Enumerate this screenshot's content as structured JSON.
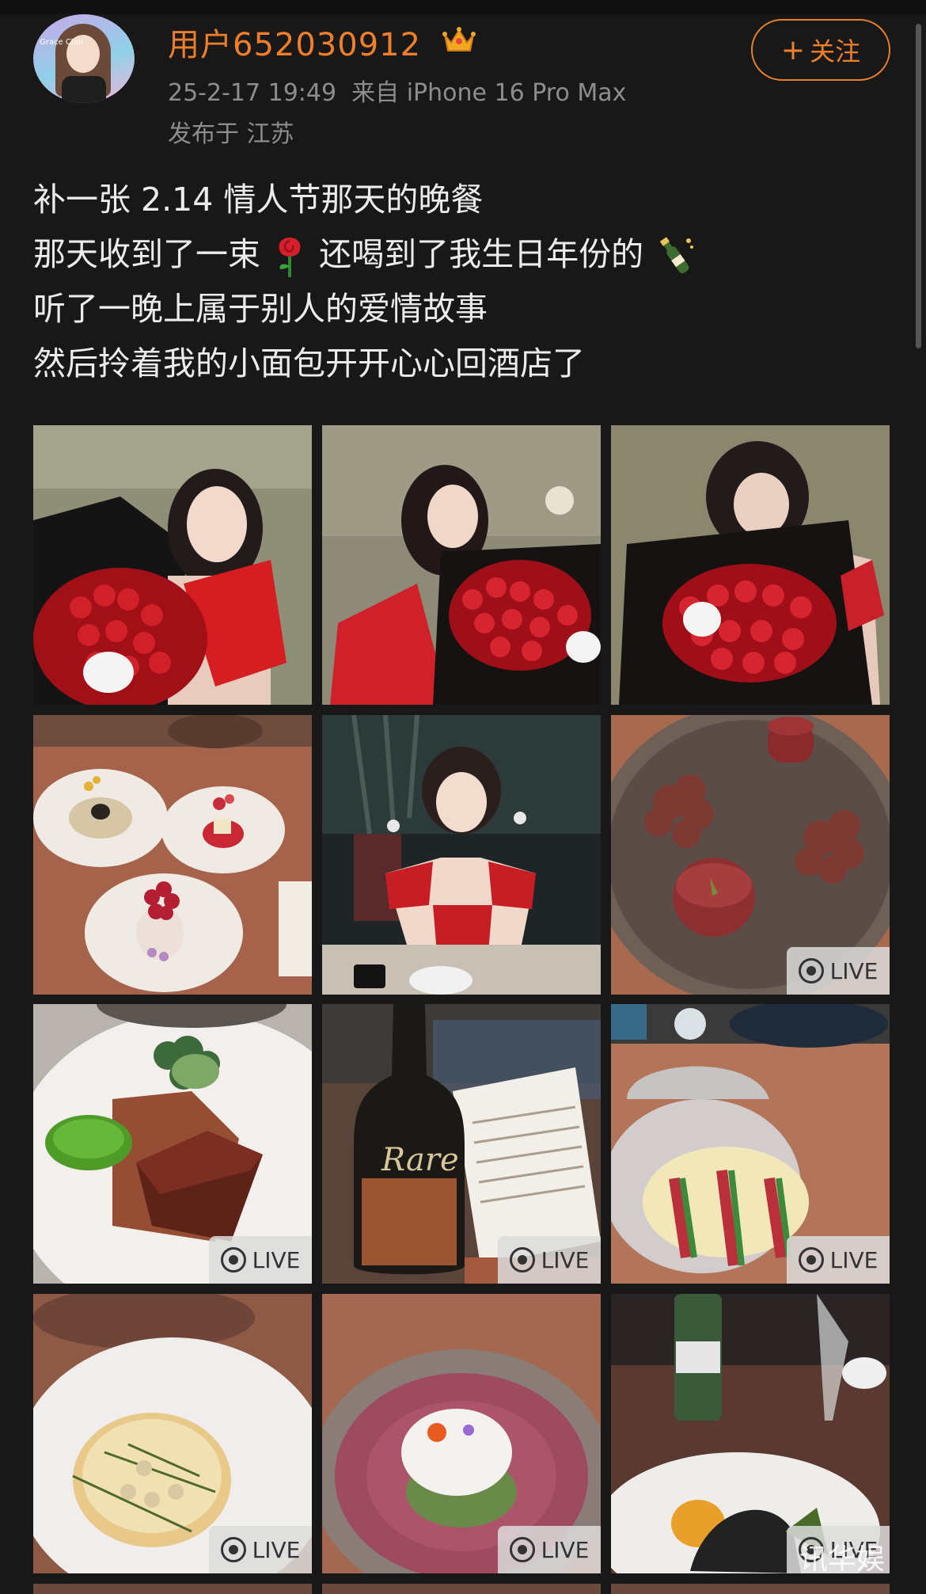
{
  "user": {
    "name": "用户652030912",
    "timestamp": "25-2-17 19:49",
    "source": "来自 iPhone 16 Pro Max",
    "location": "发布于 江苏",
    "avatar_text": "Grace Choi"
  },
  "follow_button": {
    "label": "关注",
    "plus": "+"
  },
  "post": {
    "line1": "补一张 2.14 情人节那天的晚餐",
    "line2_a": "那天收到了一束",
    "line2_b": "还喝到了我生日年份的",
    "line3": "听了一晚上属于别人的爱情故事",
    "line4": "然后拎着我的小面包开开心心回酒店了"
  },
  "photos": [
    {
      "desc": "woman-with-roses-1",
      "live": false
    },
    {
      "desc": "woman-with-roses-2",
      "live": false
    },
    {
      "desc": "woman-with-roses-3",
      "live": false
    },
    {
      "desc": "dinner-plates",
      "live": false
    },
    {
      "desc": "woman-at-table",
      "live": false
    },
    {
      "desc": "chocolate-desserts",
      "live": true
    },
    {
      "desc": "beef-dish",
      "live": true
    },
    {
      "desc": "champagne-bottle-menu",
      "live": true
    },
    {
      "desc": "glass-jar-dessert",
      "live": true
    },
    {
      "desc": "tart-dish",
      "live": true
    },
    {
      "desc": "foam-dish",
      "live": true
    },
    {
      "desc": "table-with-bottle",
      "live": true
    }
  ],
  "live_label": "LIVE",
  "watermark": "讯华娱",
  "colors": {
    "accent": "#f07f2b",
    "background": "#181818",
    "text": "#ececec",
    "meta": "#8d8d8d"
  }
}
